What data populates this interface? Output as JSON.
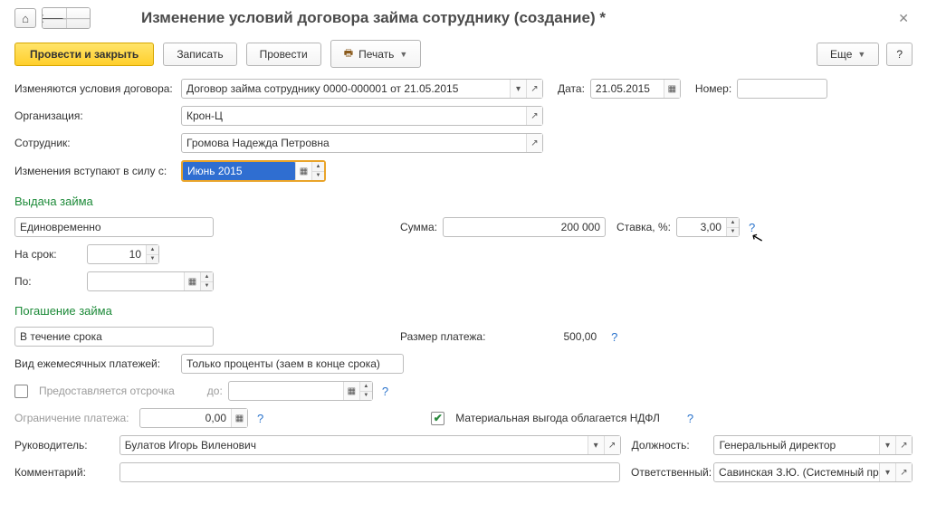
{
  "title": "Изменение условий договора займа сотруднику (создание) *",
  "toolbar": {
    "post_close": "Провести и закрыть",
    "write": "Записать",
    "post": "Провести",
    "print": "Печать",
    "more": "Еще",
    "help": "?"
  },
  "header": {
    "contract_label": "Изменяются условия договора:",
    "contract_value": "Договор займа сотруднику 0000-000001 от 21.05.2015",
    "date_label": "Дата:",
    "date_value": "21.05.2015",
    "number_label": "Номер:",
    "number_value": "",
    "org_label": "Организация:",
    "org_value": "Крон-Ц",
    "emp_label": "Сотрудник:",
    "emp_value": "Громова Надежда Петровна",
    "effective_label": "Изменения вступают в силу с:",
    "effective_value": "Июнь 2015"
  },
  "loan": {
    "section_title": "Выдача займа",
    "mode": "Единовременно",
    "sum_label": "Сумма:",
    "sum_value": "200 000",
    "rate_label": "Ставка, %:",
    "rate_value": "3,00",
    "term_label": "На срок:",
    "term_value": "10",
    "until_label": "По:",
    "until_value": ""
  },
  "repay": {
    "section_title": "Погашение займа",
    "mode": "В течение срока",
    "pay_size_label": "Размер платежа:",
    "pay_size_value": "500,00",
    "monthly_label": "Вид ежемесячных платежей:",
    "monthly_value": "Только проценты (заем в конце срока)",
    "defer_label": "Предоставляется отсрочка",
    "defer_until_label": "до:",
    "defer_until_value": "",
    "limit_label": "Ограничение платежа:",
    "limit_value": "0,00",
    "ndfl_label": "Материальная выгода облагается НДФЛ"
  },
  "footer": {
    "manager_label": "Руководитель:",
    "manager_value": "Булатов Игорь Виленович",
    "position_label": "Должность:",
    "position_value": "Генеральный директор",
    "comment_label": "Комментарий:",
    "comment_value": "",
    "responsible_label": "Ответственный:",
    "responsible_value": "Савинская З.Ю. (Системный прог"
  }
}
